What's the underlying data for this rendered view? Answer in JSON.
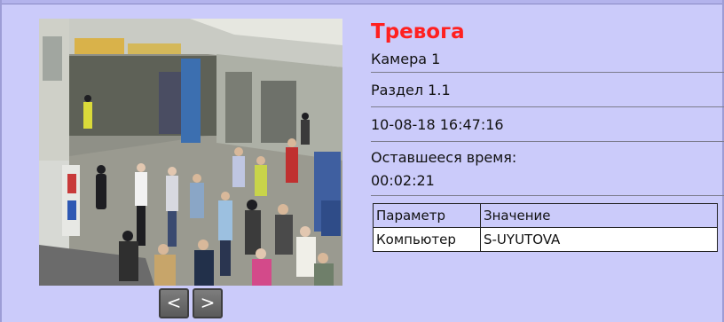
{
  "alarm": {
    "title": "Тревога",
    "camera": "Камера 1",
    "section": "Раздел 1.1",
    "timestamp": "10-08-18 16:47:16",
    "remaining_label": "Оставшееся время:",
    "remaining_value": "00:02:21"
  },
  "params": {
    "headers": [
      "Параметр",
      "Значение"
    ],
    "rows": [
      [
        "Компьютер",
        "S-UYUTOVA"
      ]
    ]
  },
  "navigation": {
    "prev_label": "<",
    "next_label": ">"
  },
  "icons": {
    "prev": "chevron-left-icon",
    "next": "chevron-right-icon"
  },
  "colors": {
    "background": "#cbcbfa",
    "alarm_title": "#ff2020",
    "nav_button": "#5a5a5a"
  }
}
